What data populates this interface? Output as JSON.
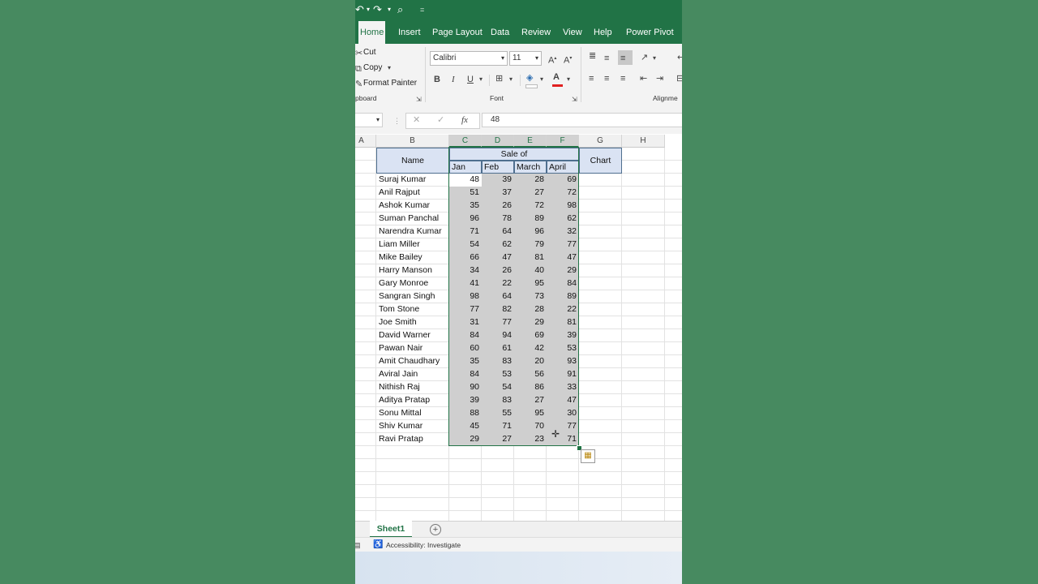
{
  "qat": {
    "undo_icon": "undo-icon",
    "redo_icon": "redo-icon",
    "preview_icon": "print-preview-icon",
    "customize": "="
  },
  "tabs": [
    "Home",
    "Insert",
    "Page Layout",
    "Data",
    "Review",
    "View",
    "Help",
    "Power Pivot"
  ],
  "clipboard": {
    "cut": "Cut",
    "copy": "Copy",
    "format_painter": "Format Painter",
    "group": "pboard"
  },
  "font": {
    "name": "Calibri",
    "size": "11",
    "grow": "A",
    "shrink": "A",
    "bold": "B",
    "italic": "I",
    "underline": "U",
    "color_letter": "A",
    "group": "Font"
  },
  "alignment": {
    "group": "Alignme"
  },
  "formula": {
    "value": "48",
    "fx": "fx"
  },
  "columns": [
    "A",
    "B",
    "C",
    "D",
    "E",
    "F",
    "G",
    "H"
  ],
  "table": {
    "name_header": "Name",
    "sale_header": "Sale of",
    "months": [
      "Jan",
      "Feb",
      "March",
      "April"
    ],
    "chart_header": "Chart",
    "rows": [
      {
        "name": "Suraj Kumar",
        "v": [
          "48",
          "39",
          "28",
          "69"
        ]
      },
      {
        "name": "Anil Rajput",
        "v": [
          "51",
          "37",
          "27",
          "72"
        ]
      },
      {
        "name": "Ashok Kumar",
        "v": [
          "35",
          "26",
          "72",
          "98"
        ]
      },
      {
        "name": "Suman Panchal",
        "v": [
          "96",
          "78",
          "89",
          "62"
        ]
      },
      {
        "name": "Narendra Kumar",
        "v": [
          "71",
          "64",
          "96",
          "32"
        ]
      },
      {
        "name": "Liam Miller",
        "v": [
          "54",
          "62",
          "79",
          "77"
        ]
      },
      {
        "name": "Mike Bailey",
        "v": [
          "66",
          "47",
          "81",
          "47"
        ]
      },
      {
        "name": "Harry Manson",
        "v": [
          "34",
          "26",
          "40",
          "29"
        ]
      },
      {
        "name": "Gary Monroe",
        "v": [
          "41",
          "22",
          "95",
          "84"
        ]
      },
      {
        "name": "Sangran Singh",
        "v": [
          "98",
          "64",
          "73",
          "89"
        ]
      },
      {
        "name": "Tom Stone",
        "v": [
          "77",
          "82",
          "28",
          "22"
        ]
      },
      {
        "name": "Joe Smith",
        "v": [
          "31",
          "77",
          "29",
          "81"
        ]
      },
      {
        "name": "David Warner",
        "v": [
          "84",
          "94",
          "69",
          "39"
        ]
      },
      {
        "name": "Pawan Nair",
        "v": [
          "60",
          "61",
          "42",
          "53"
        ]
      },
      {
        "name": "Amit Chaudhary",
        "v": [
          "35",
          "83",
          "20",
          "93"
        ]
      },
      {
        "name": "Aviral Jain",
        "v": [
          "84",
          "53",
          "56",
          "91"
        ]
      },
      {
        "name": "Nithish Raj",
        "v": [
          "90",
          "54",
          "86",
          "33"
        ]
      },
      {
        "name": "Aditya Pratap",
        "v": [
          "39",
          "83",
          "27",
          "47"
        ]
      },
      {
        "name": "Sonu Mittal",
        "v": [
          "88",
          "55",
          "95",
          "30"
        ]
      },
      {
        "name": "Shiv Kumar",
        "v": [
          "45",
          "71",
          "70",
          "77"
        ]
      },
      {
        "name": "Ravi Pratap",
        "v": [
          "29",
          "27",
          "23",
          "71"
        ]
      }
    ]
  },
  "sheet": {
    "name": "Sheet1",
    "add": "+"
  },
  "status": {
    "accessibility": "Accessibility: Investigate"
  },
  "colors": {
    "excel_green": "#217346",
    "background": "#478a60",
    "header_fill": "#dae3f3",
    "selection": "#cfcfcf"
  }
}
